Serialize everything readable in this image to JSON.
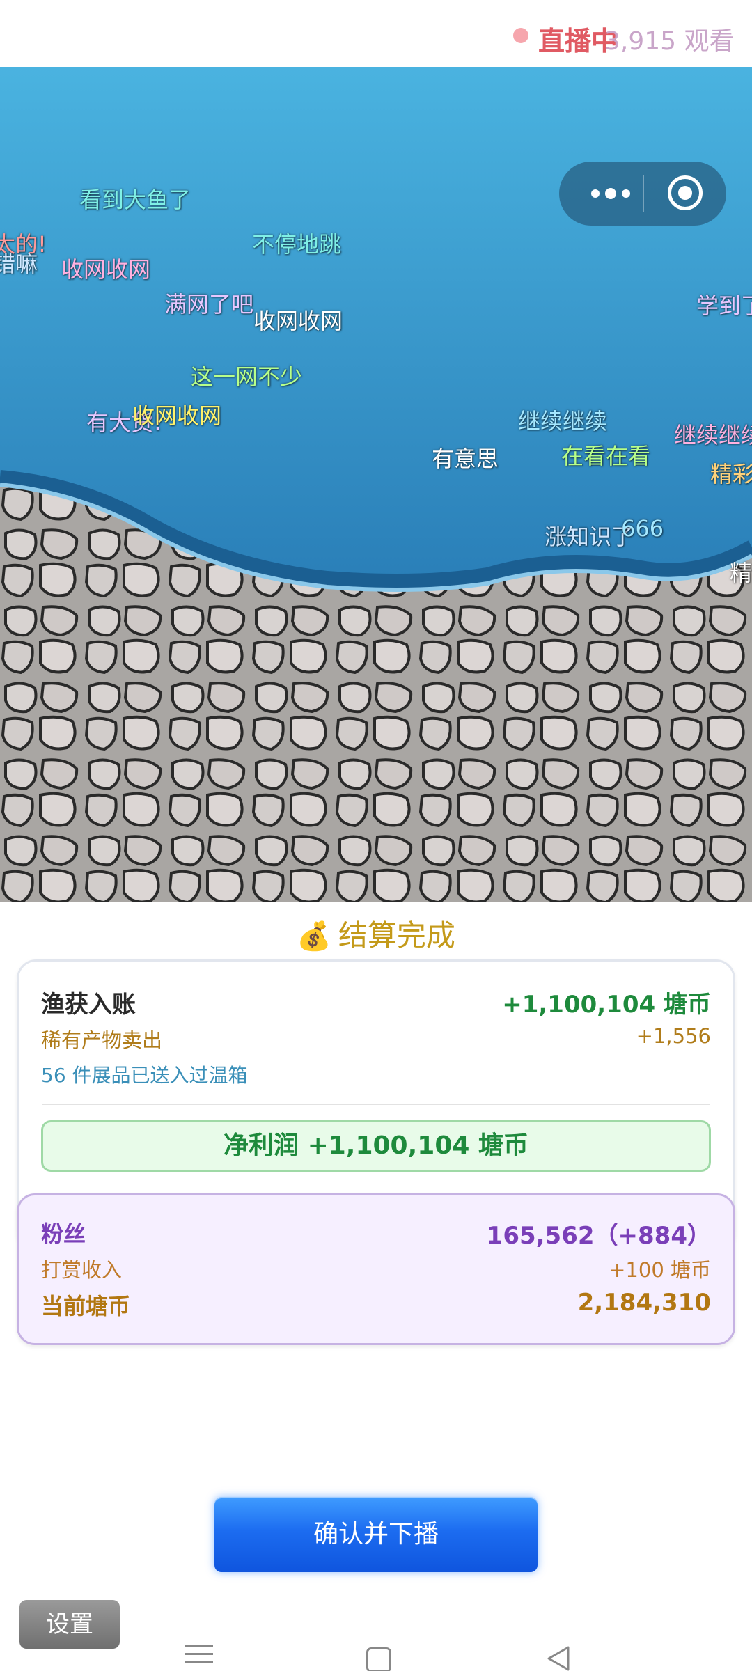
{
  "live": {
    "status_label": "直播中",
    "viewer_count": "3,915 观看"
  },
  "capsule": {
    "more_icon": "more-dots-icon",
    "close_icon": "target-circle-icon"
  },
  "danmaku": [
    {
      "text": "看到大鱼了",
      "color": "#7ff0e6"
    },
    {
      "text": "太的!",
      "color": "#ff9a9a"
    },
    {
      "text": "错嘛",
      "color": "#cfe7ff"
    },
    {
      "text": "不停地跳",
      "color": "#7ff0e6"
    },
    {
      "text": "收网收网",
      "color": "#ffb1e0"
    },
    {
      "text": "满网了吧",
      "color": "#e6c7ff"
    },
    {
      "text": "收网收网",
      "color": "#ffffff"
    },
    {
      "text": "学到了",
      "color": "#e6c7ff"
    },
    {
      "text": "这一网不少",
      "color": "#b7ff8a"
    },
    {
      "text": "有大货!",
      "color": "#e6c7ff"
    },
    {
      "text": "收网收网",
      "color": "#fff36b"
    },
    {
      "text": "继续继续",
      "color": "#a5e8ff"
    },
    {
      "text": "继续继续",
      "color": "#ffb1e0"
    },
    {
      "text": "有意思",
      "color": "#ffffff"
    },
    {
      "text": "在看在看",
      "color": "#b7ff8a"
    },
    {
      "text": "精彩",
      "color": "#ffd27a"
    },
    {
      "text": "涨知识了",
      "color": "#cfe7ff"
    },
    {
      "text": "666",
      "color": "#a5e8ff"
    },
    {
      "text": "精",
      "color": "#ffffff"
    }
  ],
  "settlement": {
    "title": "结算完成",
    "title_icon": "money-bag-icon",
    "catch_label": "渔获入账",
    "catch_value": "+1,100,104 塘币",
    "rare_label": "稀有产物卖出",
    "rare_value": "+1,556",
    "exhibit_note": "56 件展品已送入过温箱",
    "net_profit": "净利润 +1,100,104 塘币",
    "colors": {
      "gold": "#c49a1a",
      "green": "#1e8a3c",
      "purple": "#7a3fb8",
      "blue_note": "#3a8fb8"
    }
  },
  "fans": {
    "fans_label": "粉丝",
    "fans_value": "165,562（+884）",
    "tip_label": "打赏收入",
    "tip_value": "+100 塘币",
    "coins_label": "当前塘币",
    "coins_value": "2,184,310"
  },
  "actions": {
    "confirm_label": "确认并下播",
    "settings_label": "设置"
  },
  "nav": {
    "menu_icon": "menu-icon",
    "home_icon": "home-icon",
    "back_icon": "back-icon"
  }
}
